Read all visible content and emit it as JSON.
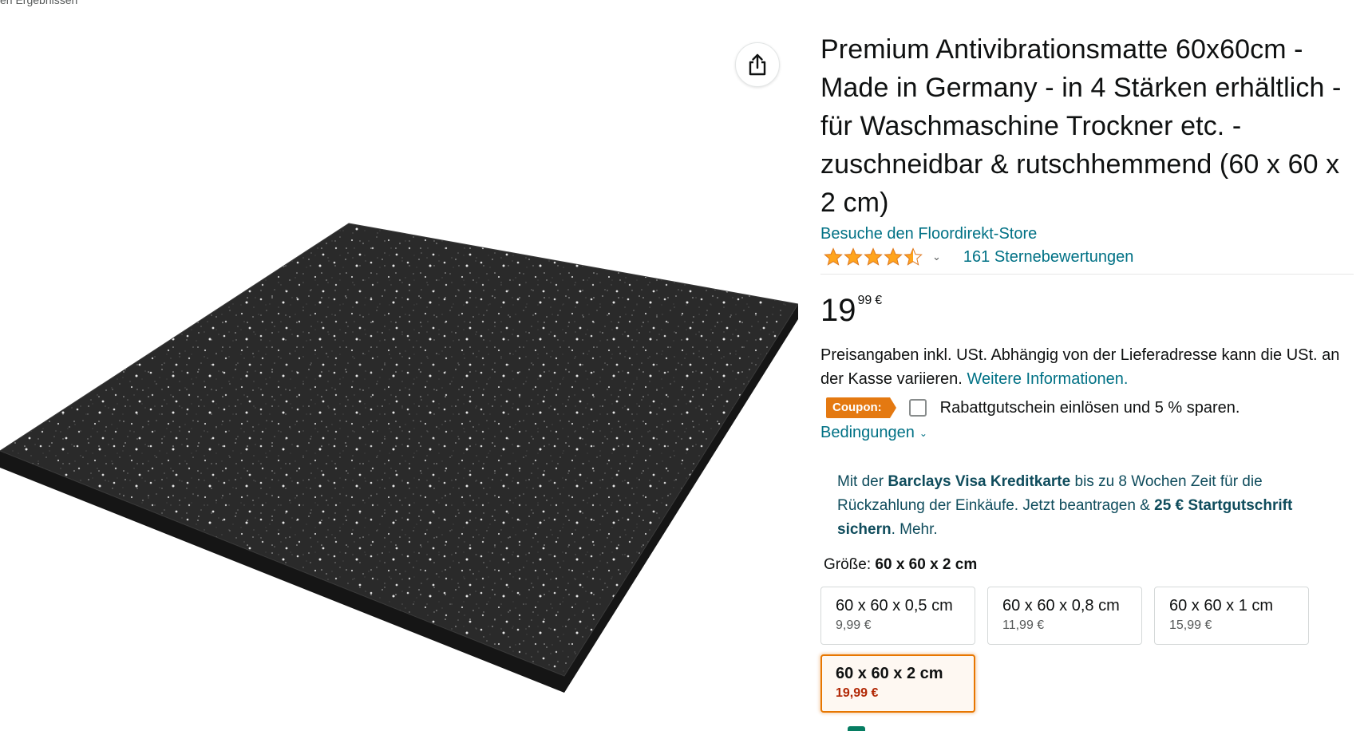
{
  "breadcrumb": {
    "text": "en Ergebnissen"
  },
  "share": {
    "icon": "share-icon"
  },
  "product": {
    "title": "Premium Antivibrationsmatte 60x60cm - Made in Germany - in 4 Stärken erhältlich - für Waschmaschine Trockner etc. - zuschneidbar & rutschhemmend (60 x 60 x 2 cm)",
    "store_link": "Besuche den Floordirekt-Store",
    "rating": {
      "stars": 4.5,
      "count_label": "161 Sternebewertungen"
    },
    "price": {
      "whole": "19",
      "fraction": "99",
      "currency": "€"
    },
    "tax_info": "Preisangaben inkl. USt. Abhängig von der Lieferadresse kann die USt. an der Kasse variieren.",
    "tax_link": "Weitere Informationen.",
    "coupon": {
      "badge": "Coupon:",
      "text": "Rabattgutschein einlösen und 5 % sparen.",
      "conditions": "Bedingungen"
    },
    "barclays": {
      "prefix": "Mit der ",
      "card": "Barclays Visa Kreditkarte",
      "middle": " bis zu 8 Wochen Zeit für die Rückzahlung der Einkäufe. Jetzt beantragen & ",
      "bonus": "25 € Startgutschrift sichern",
      "suffix": ". Mehr."
    },
    "size": {
      "label": "Größe: ",
      "selected": "60 x 60 x 2 cm",
      "options": [
        {
          "name": "60 x 60 x 0,5 cm",
          "price": "9,99 €"
        },
        {
          "name": "60 x 60 x 0,8 cm",
          "price": "11,99 €"
        },
        {
          "name": "60 x 60 x 1 cm",
          "price": "15,99 €"
        },
        {
          "name": "60 x 60 x 2 cm",
          "price": "19,99 €"
        }
      ]
    }
  },
  "colors": {
    "link": "#007185",
    "coupon": "#e47911",
    "selected_border": "#e77600",
    "deal_price": "#b12704"
  }
}
